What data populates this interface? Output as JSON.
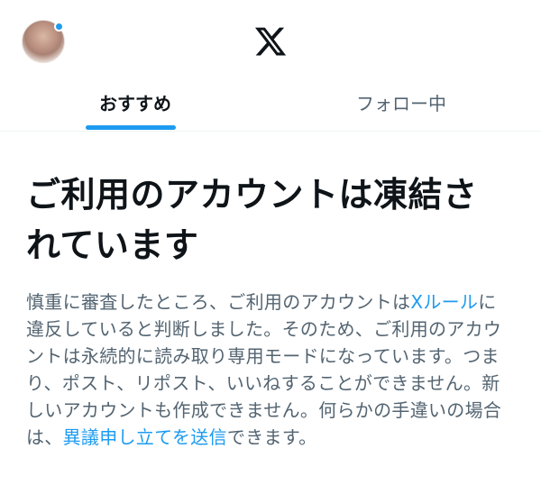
{
  "header": {
    "logo_icon": "x-logo-icon",
    "avatar_icon": "profile-avatar",
    "notification_dot_color": "#1d9bf0"
  },
  "tabs": [
    {
      "label": "おすすめ",
      "active": true
    },
    {
      "label": "フォロー中",
      "active": false
    }
  ],
  "notice": {
    "title": "ご利用のアカウントは凍結されています",
    "body_1": "慎重に審査したところ、ご利用のアカウントは",
    "link_rules": "Xルール",
    "body_2": "に違反していると判断しました。そのため、ご利用のアカウントは永続的に読み取り専用モードになっています。つまり、ポスト、リポスト、いいねすることができません。新しいアカウントも作成できません。何らかの手違いの場合は、",
    "link_appeal": "異議申し立てを送信",
    "body_3": "できます。"
  },
  "colors": {
    "accent": "#1d9bf0",
    "text_primary": "#0f1419",
    "text_secondary": "#536471"
  }
}
